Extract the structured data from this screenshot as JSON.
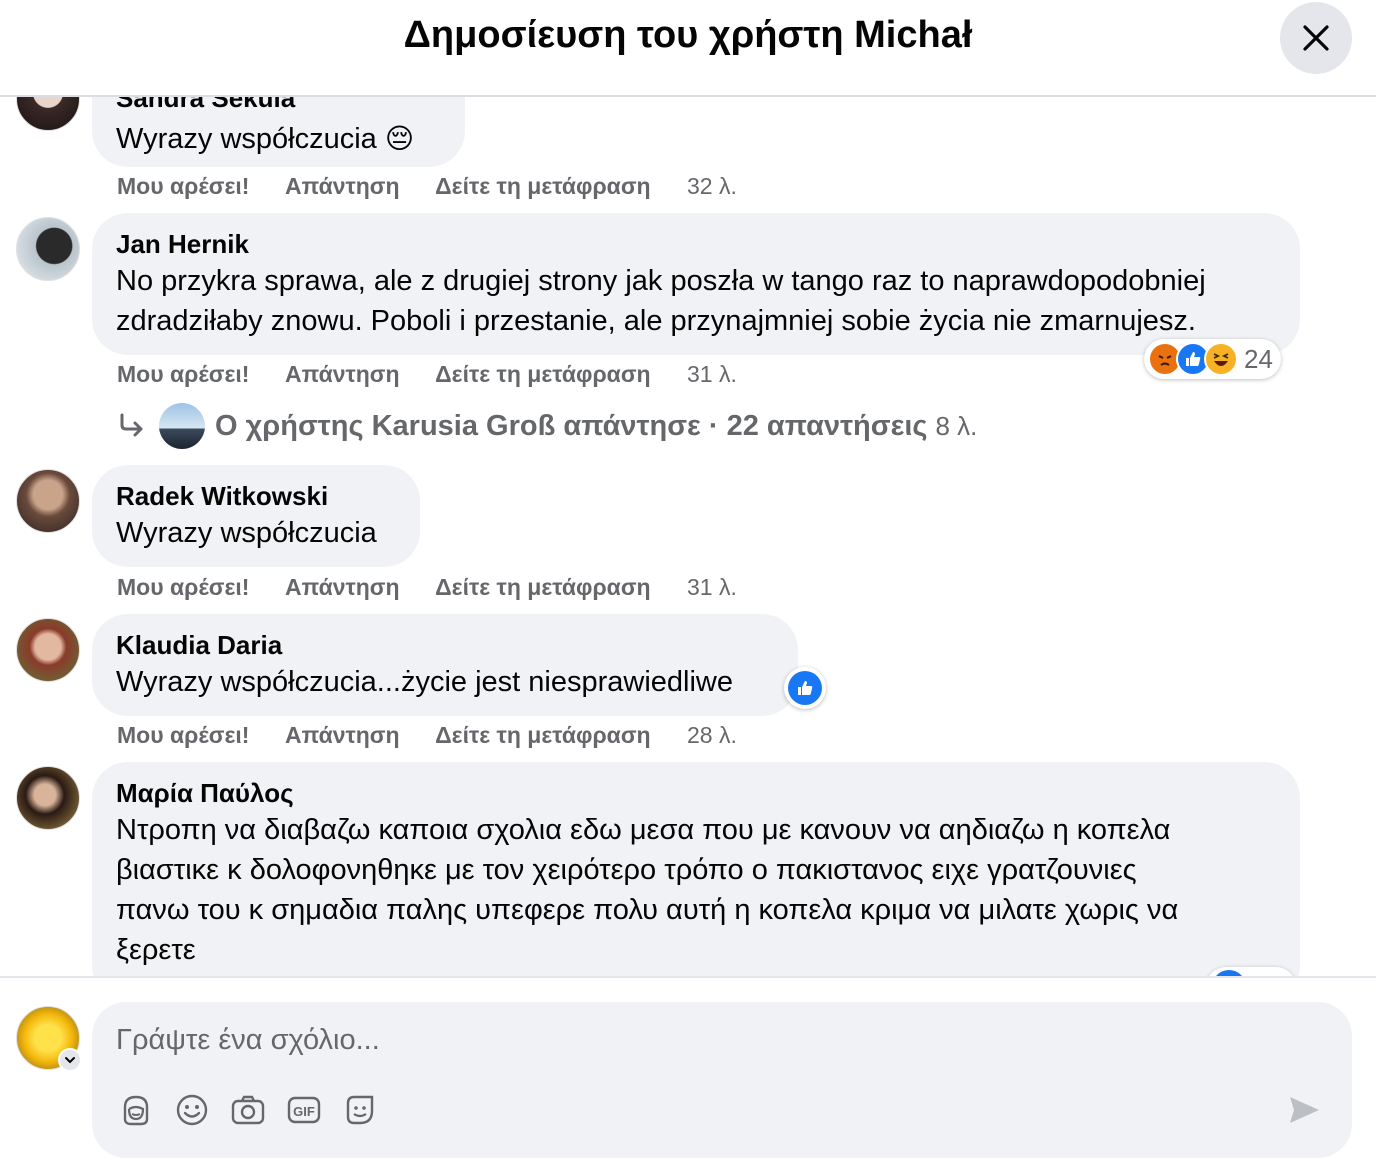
{
  "header": {
    "title": "Δημοσίευση του χρήστη Michał"
  },
  "actions": {
    "like": "Μου αρέσει!",
    "reply": "Απάντηση",
    "translate": "Δείτε τη μετάφραση"
  },
  "comments": [
    {
      "author": "Sandra Sekula",
      "text": "Wyrazy współczucia",
      "emoji": "😔",
      "time": "32 λ."
    },
    {
      "author": "Jan Hernik",
      "text_lines": [
        "No przykra sprawa, ale z drugiej strony jak poszła w tango raz to naprawdopodobniej",
        "zdradziłaby znowu. Poboli i przestanie, ale przynajmniej sobie życia nie zmarnujesz."
      ],
      "time": "31 λ.",
      "reaction_count": "24"
    },
    {
      "author": "Radek Witkowski",
      "text": "Wyrazy współczucia",
      "time": "31 λ."
    },
    {
      "author": "Klaudia Daria",
      "text": "Wyrazy współczucia...życie jest niesprawiedliwe",
      "time": "28 λ."
    },
    {
      "author": "Μαρία Παύλος",
      "text_lines": [
        "Ντροπη να διαβαζω καποια σχολια εδω μεσα που με κανουν να αηδιαζω η κοπελα",
        "βιαστικε κ δολοφονηθηκε με τον χειρότερο τρόπο ο πακιστανος ειχε γρατζουνιες",
        "πανω του κ σημαδια παλης υπεφερε πολυ αυτή η κοπελα κριμα να μιλατε χωρις να",
        "ξερετε"
      ]
    }
  ],
  "replies": {
    "text": "Ο χρήστης Karusia Groß απάντησε · 22 απαντήσεις",
    "time": "8 λ."
  },
  "composer": {
    "placeholder": "Γράψτε ένα σχόλιο..."
  },
  "colors": {
    "bubble": "#f0f2f5",
    "secondary_text": "#65676b",
    "like_blue": "#1877f2",
    "angry": "#e9710f",
    "haha": "#f7b125"
  },
  "icons": [
    "close-icon",
    "reply-arrow-icon",
    "like-icon",
    "angry-icon",
    "haha-icon",
    "avatar-icon",
    "emoji-icon",
    "camera-icon",
    "gif-icon",
    "sticker-icon",
    "send-icon",
    "chevron-down-icon"
  ]
}
